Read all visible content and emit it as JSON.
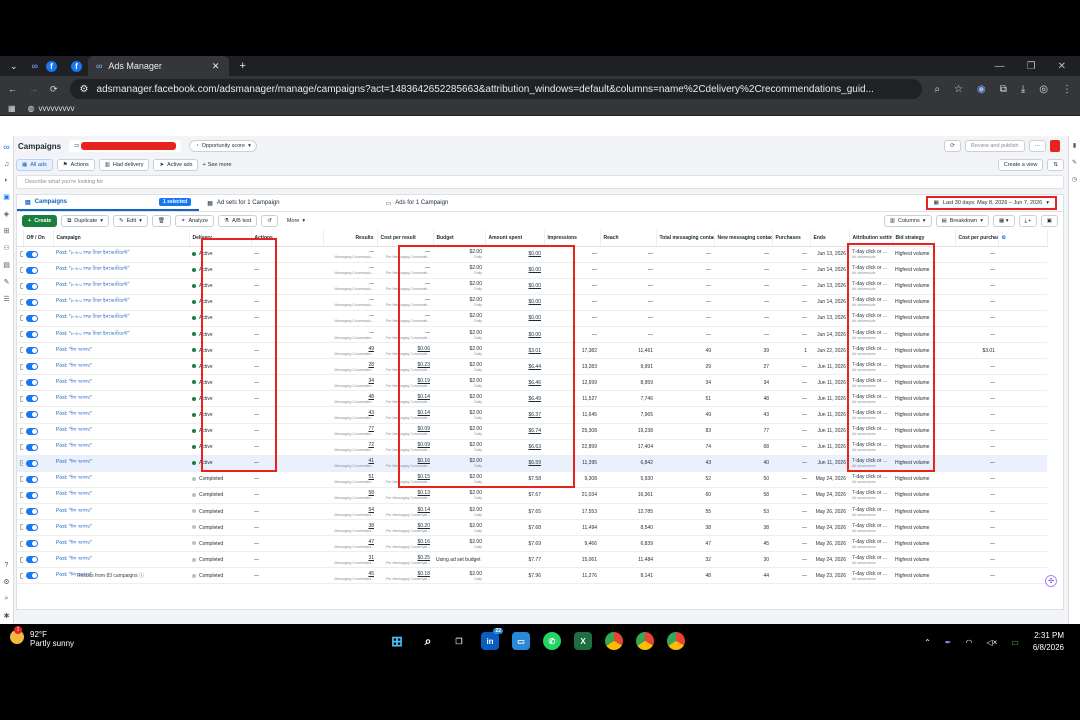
{
  "browser": {
    "tabs": [
      {
        "label": "Ads Manager"
      }
    ],
    "url": "adsmanager.facebook.com/adsmanager/manage/campaigns?act=1483642652285663&attribution_windows=default&columns=name%2Cdelivery%2Crecommendations_guid...",
    "bookmark": "vvvvvvvvv"
  },
  "header": {
    "title": "Campaigns",
    "opportunity": "Opportunity score",
    "review_publish": "Review and publish"
  },
  "filters": {
    "all_ads": "All ads",
    "actions": "Actions",
    "had_delivery": "Had delivery",
    "active_ads": "Active ads",
    "see_more": "See more",
    "search_placeholder": "Describe what you're looking for",
    "create_view": "Create a view"
  },
  "levels": {
    "campaigns": "Campaigns",
    "selected": "1 selected",
    "adsets": "Ad sets for 1 Campaign",
    "ads": "Ads for 1 Campaign",
    "date_range": "Last 30 days: May 8, 2026 – Jun 7, 2026"
  },
  "toolbar": {
    "create": "Create",
    "duplicate": "Duplicate",
    "edit": "Edit",
    "analyze": "Analyze",
    "ab_test": "A/B test",
    "more": "More",
    "columns": "Columns",
    "breakdown": "Breakdown"
  },
  "table": {
    "headers": [
      "Off / On",
      "Campaign",
      "Delivery",
      "Actions",
      "Results",
      "Cost per result",
      "Budget",
      "Amount spent",
      "Impressions",
      "Reach",
      "Total messaging contacts",
      "New messaging contacts",
      "Purchases",
      "Ends",
      "Attribution setting",
      "Bid strategy",
      "Cost per purchase"
    ],
    "rows": [
      {
        "campaign": "Post: \"৮-৮০ লক্ষ টাকা ইনভেস্টমেন্ট\"",
        "delivery": "Active",
        "results": "—",
        "cpr": "—",
        "spent": "$0.00",
        "impr": "—",
        "reach": "—",
        "total": "—",
        "new": "—",
        "purch": "—",
        "ends": "Jun 13, 2026",
        "bid": "Highest volume",
        "cpp": "—"
      },
      {
        "campaign": "Post: \"৮-৮০ লক্ষ টাকা ইনভেস্টমেন্ট\"",
        "delivery": "Active",
        "results": "—",
        "cpr": "—",
        "spent": "$0.00",
        "impr": "—",
        "reach": "—",
        "total": "—",
        "new": "—",
        "purch": "—",
        "ends": "Jun 14, 2026",
        "bid": "Highest volume",
        "cpp": "—"
      },
      {
        "campaign": "Post: \"৮-৮০ লক্ষ টাকা ইনভেস্টমেন্ট\"",
        "delivery": "Active",
        "results": "—",
        "cpr": "—",
        "spent": "$0.00",
        "impr": "—",
        "reach": "—",
        "total": "—",
        "new": "—",
        "purch": "—",
        "ends": "Jun 13, 2026",
        "bid": "Highest volume",
        "cpp": "—"
      },
      {
        "campaign": "Post: \"৮-৮০ লক্ষ টাকা ইনভেস্টমেন্ট\"",
        "delivery": "Active",
        "results": "—",
        "cpr": "—",
        "spent": "$0.00",
        "impr": "—",
        "reach": "—",
        "total": "—",
        "new": "—",
        "purch": "—",
        "ends": "Jun 14, 2026",
        "bid": "Highest volume",
        "cpp": "—"
      },
      {
        "campaign": "Post: \"৮-৮০ লক্ষ টাকা ইনভেস্টমেন্ট\"",
        "delivery": "Active",
        "results": "—",
        "cpr": "—",
        "spent": "$0.00",
        "impr": "—",
        "reach": "—",
        "total": "—",
        "new": "—",
        "purch": "—",
        "ends": "Jun 13, 2026",
        "bid": "Highest volume",
        "cpp": "—"
      },
      {
        "campaign": "Post: \"৮-৮০ লক্ষ টাকা ইনভেস্টমেন্ট\"",
        "delivery": "Active",
        "results": "—",
        "cpr": "—",
        "spent": "$0.00",
        "impr": "—",
        "reach": "—",
        "total": "—",
        "new": "—",
        "purch": "—",
        "ends": "Jun 14, 2026",
        "bid": "Highest volume",
        "cpp": "—"
      },
      {
        "campaign": "Post: \"ঈদ অফার\"",
        "delivery": "Active",
        "results": "49",
        "cpr": "$0.06",
        "spent": "$3.01",
        "impr": "17,382",
        "reach": "11,461",
        "total": "49",
        "new": "39",
        "purch": "1",
        "ends": "Jun 22, 2026",
        "bid": "Highest volume",
        "cpp": "$3.01"
      },
      {
        "campaign": "Post: \"ঈদ অফার\"",
        "delivery": "Active",
        "results": "28",
        "cpr": "$0.23",
        "spent": "$6.44",
        "impr": "13,283",
        "reach": "9,991",
        "total": "29",
        "new": "27",
        "purch": "—",
        "ends": "Jun 11, 2026",
        "bid": "Highest volume",
        "cpp": "—"
      },
      {
        "campaign": "Post: \"ঈদ অফার\"",
        "delivery": "Active",
        "results": "34",
        "cpr": "$0.19",
        "spent": "$6.46",
        "impr": "12,699",
        "reach": "8,959",
        "total": "34",
        "new": "34",
        "purch": "—",
        "ends": "Jun 11, 2026",
        "bid": "Highest volume",
        "cpp": "—"
      },
      {
        "campaign": "Post: \"ঈদ অফার\"",
        "delivery": "Active",
        "results": "48",
        "cpr": "$0.14",
        "spent": "$6.49",
        "impr": "11,527",
        "reach": "7,746",
        "total": "51",
        "new": "48",
        "purch": "—",
        "ends": "Jun 11, 2026",
        "bid": "Highest volume",
        "cpp": "—"
      },
      {
        "campaign": "Post: \"ঈদ অফার\"",
        "delivery": "Active",
        "results": "43",
        "cpr": "$0.14",
        "spent": "$6.37",
        "impr": "11,645",
        "reach": "7,965",
        "total": "49",
        "new": "43",
        "purch": "—",
        "ends": "Jun 11, 2026",
        "bid": "Highest volume",
        "cpp": "—"
      },
      {
        "campaign": "Post: \"ঈদ অফার\"",
        "delivery": "Active",
        "results": "77",
        "cpr": "$0.09",
        "spent": "$6.74",
        "impr": "25,308",
        "reach": "19,238",
        "total": "83",
        "new": "77",
        "purch": "—",
        "ends": "Jun 11, 2026",
        "bid": "Highest volume",
        "cpp": "—"
      },
      {
        "campaign": "Post: \"ঈদ অফার\"",
        "delivery": "Active",
        "results": "72",
        "cpr": "$0.09",
        "spent": "$6.63",
        "impr": "22,899",
        "reach": "17,404",
        "total": "74",
        "new": "68",
        "purch": "—",
        "ends": "Jun 11, 2026",
        "bid": "Highest volume",
        "cpp": "—"
      },
      {
        "campaign": "Post: \"ঈদ অফার\"",
        "delivery": "Active",
        "results": "41",
        "cpr": "$0.16",
        "spent": "$6.59",
        "impr": "11,395",
        "reach": "6,842",
        "total": "43",
        "new": "40",
        "purch": "—",
        "ends": "Jun 11, 2026",
        "bid": "Highest volume",
        "cpp": "—",
        "selected": true
      },
      {
        "campaign": "Post: \"ঈদ অফার\"",
        "delivery": "Completed",
        "results": "51",
        "cpr": "$0.15",
        "spent": "$7.58",
        "impr": "9,308",
        "reach": "5,930",
        "total": "52",
        "new": "50",
        "purch": "—",
        "ends": "May 24, 2026",
        "bid": "Highest volume",
        "cpp": "—"
      },
      {
        "campaign": "Post: \"ঈদ অফার\"",
        "delivery": "Completed",
        "results": "58",
        "cpr": "$0.13",
        "spent": "$7.67",
        "impr": "21,034",
        "reach": "16,361",
        "total": "60",
        "new": "58",
        "purch": "—",
        "ends": "May 24, 2026",
        "bid": "Highest volume",
        "cpp": "—"
      },
      {
        "campaign": "Post: \"ঈদ অফার\"",
        "delivery": "Completed",
        "results": "54",
        "cpr": "$0.14",
        "spent": "$7.65",
        "impr": "17,553",
        "reach": "12,785",
        "total": "55",
        "new": "53",
        "purch": "—",
        "ends": "May 26, 2026",
        "bid": "Highest volume",
        "cpp": "—"
      },
      {
        "campaign": "Post: \"ঈদ অফার\"",
        "delivery": "Completed",
        "results": "38",
        "cpr": "$0.20",
        "spent": "$7.68",
        "impr": "11,494",
        "reach": "8,540",
        "total": "38",
        "new": "38",
        "purch": "—",
        "ends": "May 24, 2026",
        "bid": "Highest volume",
        "cpp": "—"
      },
      {
        "campaign": "Post: \"ঈদ অফার\"",
        "delivery": "Completed",
        "results": "47",
        "cpr": "$0.16",
        "spent": "$7.69",
        "impr": "9,466",
        "reach": "6,839",
        "total": "47",
        "new": "45",
        "purch": "—",
        "ends": "May 26, 2026",
        "bid": "Highest volume",
        "cpp": "—"
      },
      {
        "campaign": "Post: \"ঈদ অফার\"",
        "delivery": "Completed",
        "results": "31",
        "cpr": "$0.25",
        "spent": "$7.77",
        "impr": "15,061",
        "reach": "11,484",
        "total": "32",
        "new": "30",
        "purch": "—",
        "ends": "May 24, 2026",
        "bid": "Highest volume",
        "cpp": "—",
        "budget_text": "Using ad set budget"
      },
      {
        "campaign": "Post: \"ঈদ অফার\"",
        "delivery": "Completed",
        "results": "45",
        "cpr": "$0.18",
        "spent": "$7.96",
        "impr": "11,276",
        "reach": "8,141",
        "total": "48",
        "new": "44",
        "purch": "—",
        "ends": "May 23, 2026",
        "bid": "Highest volume",
        "cpp": "—"
      }
    ],
    "result_sub": "Messaging Conversatio...",
    "cpr_sub": "Per Messaging Conversati...",
    "budget": "$2.00",
    "budget_sub": "Daily",
    "attribution": "7-day click or ...",
    "attribution_sub": "All conversions",
    "footer": "Results from 83 campaigns"
  },
  "taskbar": {
    "temp": "92°F",
    "weather": "Partly sunny",
    "weather_badge": "1",
    "time": "2:31 PM",
    "date": "6/8/2026",
    "store_badge": "22"
  },
  "colors": {
    "brand": "#1877f2",
    "highlight": "#e8221c",
    "active": "#1a7f3c"
  }
}
